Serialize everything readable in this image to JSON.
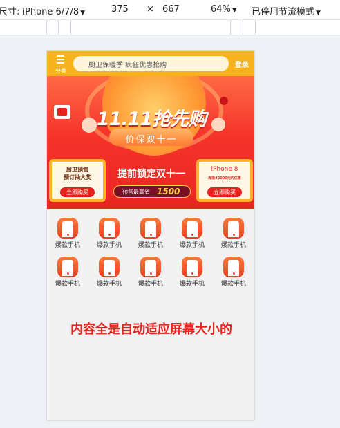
{
  "devtools": {
    "device_label": "尺寸: iPhone 6/7/8",
    "width": "375",
    "times": "×",
    "height": "667",
    "zoom": "64%",
    "throttle": "已停用节流模式"
  },
  "header": {
    "menu_label": "分类",
    "search_text": "厨卫保暖季 疯狂优惠抢购",
    "login": "登录"
  },
  "banner": {
    "title": "11.11抢先购",
    "subtitle": "价保双十一",
    "left_card": {
      "line1": "厨卫预售",
      "line2": "预订抽大奖",
      "button": "立即购买"
    },
    "center": {
      "title": "提前锁定双十一",
      "label": "预售最高省",
      "amount": "1500"
    },
    "right_card": {
      "line1": "iPhone 8",
      "line2": "库能42000元的优惠",
      "button": "立即购买"
    }
  },
  "products": [
    {
      "label": "爆款手机"
    },
    {
      "label": "爆款手机"
    },
    {
      "label": "爆款手机"
    },
    {
      "label": "爆款手机"
    },
    {
      "label": "爆款手机"
    },
    {
      "label": "爆款手机"
    },
    {
      "label": "爆款手机"
    },
    {
      "label": "爆款手机"
    },
    {
      "label": "爆款手机"
    },
    {
      "label": "爆款手机"
    }
  ],
  "note": "内容全是自动适应屏幕大小的",
  "colors": {
    "header": "#f7b31e",
    "banner_red": "#e8231d",
    "note": "#e8231d"
  }
}
